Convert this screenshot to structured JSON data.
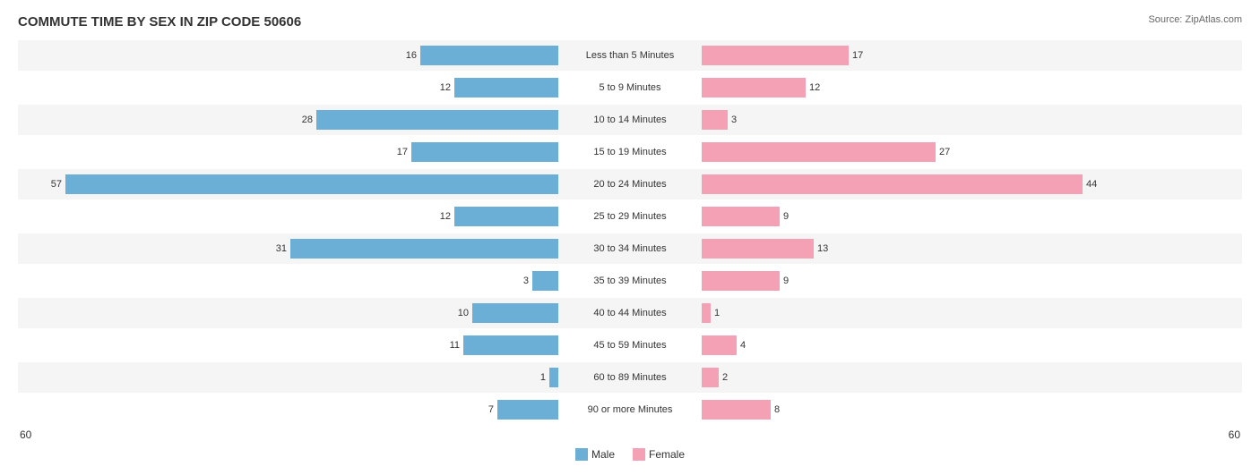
{
  "title": "COMMUTE TIME BY SEX IN ZIP CODE 50606",
  "source": "Source: ZipAtlas.com",
  "colors": {
    "male": "#6baed6",
    "female": "#f4a0b5"
  },
  "legend": {
    "male_label": "Male",
    "female_label": "Female"
  },
  "outer_label_left": "60",
  "outer_label_right": "60",
  "max_value": 57,
  "rows": [
    {
      "label": "Less than 5 Minutes",
      "male": 16,
      "female": 17
    },
    {
      "label": "5 to 9 Minutes",
      "male": 12,
      "female": 12
    },
    {
      "label": "10 to 14 Minutes",
      "male": 28,
      "female": 3
    },
    {
      "label": "15 to 19 Minutes",
      "male": 17,
      "female": 27
    },
    {
      "label": "20 to 24 Minutes",
      "male": 57,
      "female": 44
    },
    {
      "label": "25 to 29 Minutes",
      "male": 12,
      "female": 9
    },
    {
      "label": "30 to 34 Minutes",
      "male": 31,
      "female": 13
    },
    {
      "label": "35 to 39 Minutes",
      "male": 3,
      "female": 9
    },
    {
      "label": "40 to 44 Minutes",
      "male": 10,
      "female": 1
    },
    {
      "label": "45 to 59 Minutes",
      "male": 11,
      "female": 4
    },
    {
      "label": "60 to 89 Minutes",
      "male": 1,
      "female": 2
    },
    {
      "label": "90 or more Minutes",
      "male": 7,
      "female": 8
    }
  ]
}
